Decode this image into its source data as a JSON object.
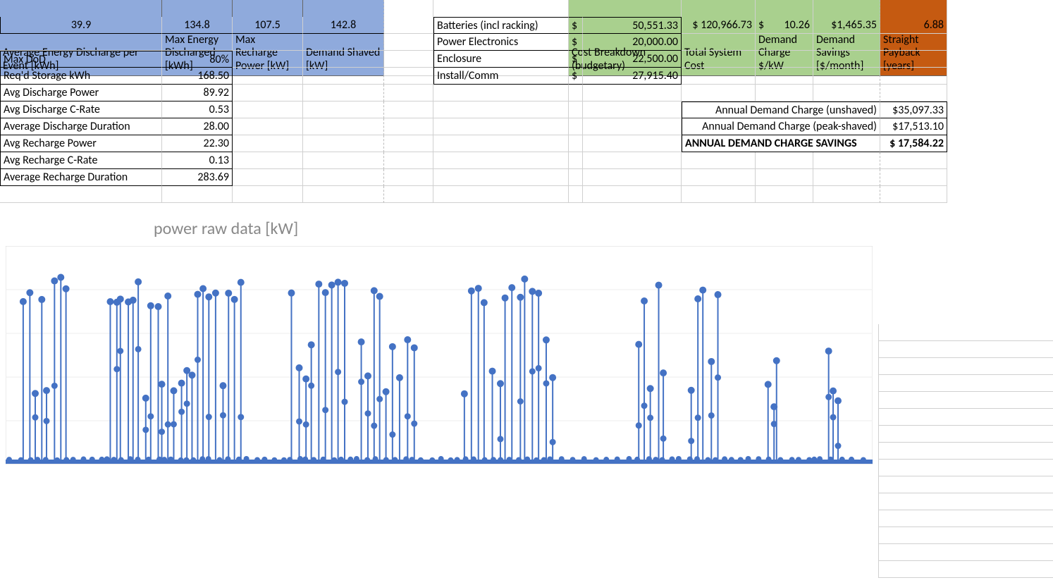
{
  "headers": {
    "avg_energy_discharge": "Average Energy Discharge per Event [kWh]",
    "max_energy_discharged": "Max Energy Discharged [kWh]",
    "max_recharge_power": "Max Recharge Power [kW]",
    "demand_shaved": "Demand Shaved [kW]",
    "cost_breakdown": "Cost Breakdown (budgetary)",
    "total_system_cost": "Total System Cost",
    "demand_charge": "Demand Charge $/kW",
    "demand_savings": "Demand Savings [$/month]",
    "straight_payback": "Straight Payback [years]"
  },
  "topvals": {
    "avg_energy_discharge": "39.9",
    "max_energy_discharged": "134.8",
    "max_recharge_power": "107.5",
    "demand_shaved": "142.8"
  },
  "left_metrics": [
    {
      "label": "Max DoD",
      "value": "80%"
    },
    {
      "label": "Req'd Storage kWh",
      "value": "168.50"
    },
    {
      "label": "Avg Discharge Power",
      "value": "89.92"
    },
    {
      "label": "Avg Discharge C-Rate",
      "value": "0.53"
    },
    {
      "label": "Average Discharge Duration",
      "value": "28.00"
    },
    {
      "label": "Avg Recharge Power",
      "value": "22.30"
    },
    {
      "label": "Avg Recharge C-Rate",
      "value": "0.13"
    },
    {
      "label": "Average Recharge Duration",
      "value": "283.69"
    }
  ],
  "cost_rows": [
    {
      "label": "Batteries (incl racking)",
      "amount": "50,551.33"
    },
    {
      "label": "Power Electronics",
      "amount": "20,000.00"
    },
    {
      "label": "Enclosure",
      "amount": "22,500.00"
    },
    {
      "label": "Install/Comm",
      "amount": "27,915.40"
    }
  ],
  "totals": {
    "total_system_cost": "$ 120,966.73",
    "demand_charge": "10.26",
    "demand_savings": "$1,465.35",
    "straight_payback": "6.88"
  },
  "annual": [
    {
      "label": "Annual Demand Charge (unshaved)",
      "value": "$35,097.33"
    },
    {
      "label": "Annual Demand Charge (peak-shaved)",
      "value": "$17,513.10"
    },
    {
      "label": "ANNUAL DEMAND CHARGE SAVINGS",
      "value": "$ 17,584.22"
    }
  ],
  "chart_data": {
    "type": "line",
    "title": "power raw data [kW]",
    "xlabel": "",
    "ylabel": "",
    "ylim": [
      0,
      150
    ],
    "note": "Time-series of power readings; peaks near 140 kW with many near-zero baseline periods. Individual timestamps and exact y-values are not labeled in the image; pattern shows clusters of spikes separated by low-load gaps.",
    "approx_peaks_kw": 140,
    "approx_baseline_kw": 0,
    "clusters": [
      {
        "start_pct": 2,
        "end_pct": 7,
        "peak": 138
      },
      {
        "start_pct": 12,
        "end_pct": 27,
        "peak": 135
      },
      {
        "start_pct": 33,
        "end_pct": 39,
        "peak": 138
      },
      {
        "start_pct": 41,
        "end_pct": 47,
        "peak": 136
      },
      {
        "start_pct": 53,
        "end_pct": 56,
        "peak": 138
      },
      {
        "start_pct": 57,
        "end_pct": 63,
        "peak": 137
      },
      {
        "start_pct": 73,
        "end_pct": 76,
        "peak": 137
      },
      {
        "start_pct": 79,
        "end_pct": 82,
        "peak": 138
      },
      {
        "start_pct": 88,
        "end_pct": 89,
        "peak": 85
      },
      {
        "start_pct": 95,
        "end_pct": 96,
        "peak": 85
      }
    ]
  }
}
